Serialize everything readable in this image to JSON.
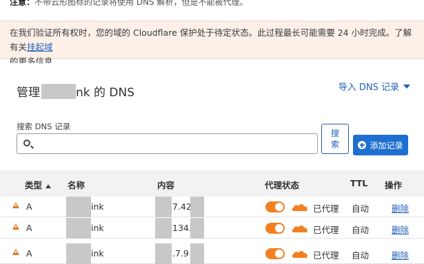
{
  "top_note": {
    "prefix": "注意：",
    "text": "不带云形图标的记录将使用 DNS 解析，但是不能被代理。"
  },
  "banner": {
    "text": "在我们验证所有权时，您的域的 Cloudflare 保护处于待定状态。此过程最长可能需要 24 小时完成。了解有关",
    "link_text": "挂起域",
    "text_end": "的更多信息"
  },
  "dns": {
    "title_prefix": "管理",
    "title_suffix": "nk 的 DNS",
    "import_label": "导入 DNS 记录"
  },
  "search": {
    "label": "搜索 DNS 记录",
    "placeholder": "",
    "button_label": "搜索"
  },
  "add_button_label": "添加记录",
  "table": {
    "columns": {
      "type": "类型",
      "name": "名称",
      "content": "内容",
      "proxy": "代理状态",
      "ttl": "TTL",
      "actions": "操作"
    },
    "rows": [
      {
        "type": "A",
        "name_suffix": "ink",
        "content_mid": "7.42.",
        "proxy_status": "已代理",
        "ttl": "自动",
        "action": "删除"
      },
      {
        "type": "A",
        "name_suffix": "ink",
        "content_mid": "134.",
        "proxy_status": "已代理",
        "ttl": "自动",
        "action": "删除"
      },
      {
        "type": "A",
        "name_suffix": "ink",
        "content_mid": ".7.9",
        "proxy_status": "已代理",
        "ttl": "自动",
        "action": "删除"
      }
    ]
  },
  "colors": {
    "accent": "#1f6fd0",
    "link": "#1f5fb8",
    "proxy_orange": "#f38020",
    "warning": "#e07a2c",
    "banner_bg": "#fcf0e8"
  }
}
